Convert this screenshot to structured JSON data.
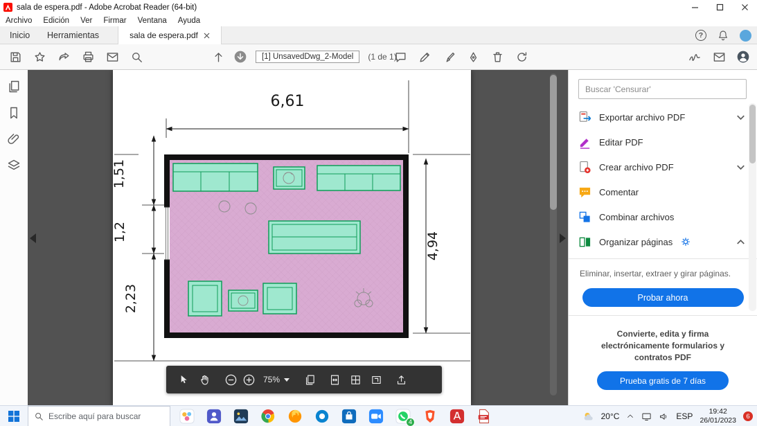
{
  "colors": {
    "accent_blue": "#1173E8",
    "acrobat_red": "#FA0F00",
    "doc_background": "#525252",
    "floor_pink": "#D9ABD2",
    "furniture_fill": "#9FE8CF",
    "furniture_stroke": "#0F9D58",
    "wall_black": "#111111"
  },
  "titlebar": {
    "title": "sala de espera.pdf - Adobe Acrobat Reader (64-bit)"
  },
  "menubar": {
    "items": [
      "Archivo",
      "Edición",
      "Ver",
      "Firmar",
      "Ventana",
      "Ayuda"
    ]
  },
  "tabs": {
    "home": "Inicio",
    "tools": "Herramientas",
    "document": "sala de espera.pdf"
  },
  "toolbar": {
    "model_label": "[1] UnsavedDwg_2-Model",
    "page_count": "(1 de 1)"
  },
  "floorplan": {
    "dim_width": "6,61",
    "dim_left_top": "1,51",
    "dim_left_mid": "1,2",
    "dim_left_bottom": "2,23",
    "dim_right": "4,94"
  },
  "zoom_bar": {
    "zoom_level": "75%"
  },
  "right_panel": {
    "search_placeholder": "Buscar 'Censurar'",
    "tools": [
      {
        "label": "Exportar archivo PDF"
      },
      {
        "label": "Editar PDF"
      },
      {
        "label": "Crear archivo PDF"
      },
      {
        "label": "Comentar"
      },
      {
        "label": "Combinar archivos"
      },
      {
        "label": "Organizar páginas"
      }
    ],
    "organize_description": "Eliminar, insertar, extraer y girar páginas.",
    "try_now": "Probar ahora",
    "promo": "Convierte, edita y firma electrónicamente formularios y contratos PDF",
    "free_trial": "Prueba gratis de 7 días"
  },
  "taskbar": {
    "search_placeholder": "Escribe aquí para buscar",
    "zoom_badge": "4",
    "weather": "20°C",
    "language": "ESP",
    "time": "19:42",
    "date": "26/01/2023",
    "notifications": "6"
  }
}
